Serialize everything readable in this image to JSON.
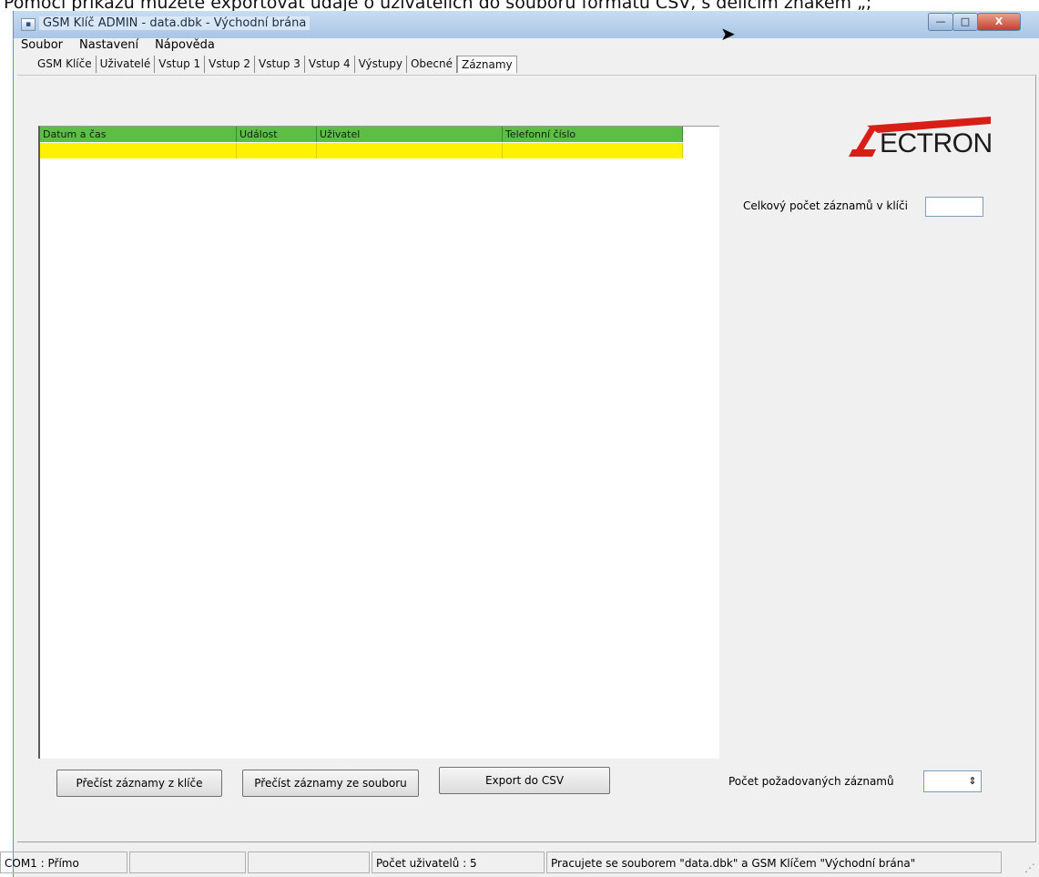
{
  "caption": "Pomocí příkazu můžete exportovat údaje o uživatelích do souboru formátu CSV, s dělicím znakem „;“",
  "window": {
    "title": "GSM Klíč ADMIN - data.dbk - Východní brána",
    "controls": {
      "minimize": "—",
      "maximize": "□",
      "close": "X"
    }
  },
  "menu": [
    "Soubor",
    "Nastavení",
    "Nápověda"
  ],
  "tabs": [
    "GSM Klíče",
    "Uživatelé",
    "Vstup 1",
    "Vstup 2",
    "Vstup 3",
    "Vstup 4",
    "Výstupy",
    "Obecné",
    "Záznamy"
  ],
  "active_tab": "Záznamy",
  "table": {
    "columns": [
      "Datum a čas",
      "Událost",
      "Uživatel",
      "Telefonní číslo"
    ],
    "rows": [
      [
        "",
        "",
        "",
        ""
      ]
    ],
    "header_color": "#5dbe46",
    "selected_row_color": "#fef200"
  },
  "logo": {
    "text": "ECTRON",
    "brand_color": "#d91e18"
  },
  "records_total": {
    "label": "Celkový počet záznamů v klíči",
    "value": ""
  },
  "buttons": {
    "read_key": "Přečíst záznamy z klíče",
    "read_file": "Přečíst záznamy ze souboru",
    "export_csv": "Export do CSV"
  },
  "requested_records": {
    "label": "Počet požadovaných záznamů",
    "value": ""
  },
  "statusbar": {
    "port": "COM1 : Přímo",
    "empty1": "",
    "empty2": "",
    "users": "Počet uživatelů : 5",
    "file_info": "Pracujete se souborem \"data.dbk\" a GSM Klíčem \"Východní brána\""
  }
}
